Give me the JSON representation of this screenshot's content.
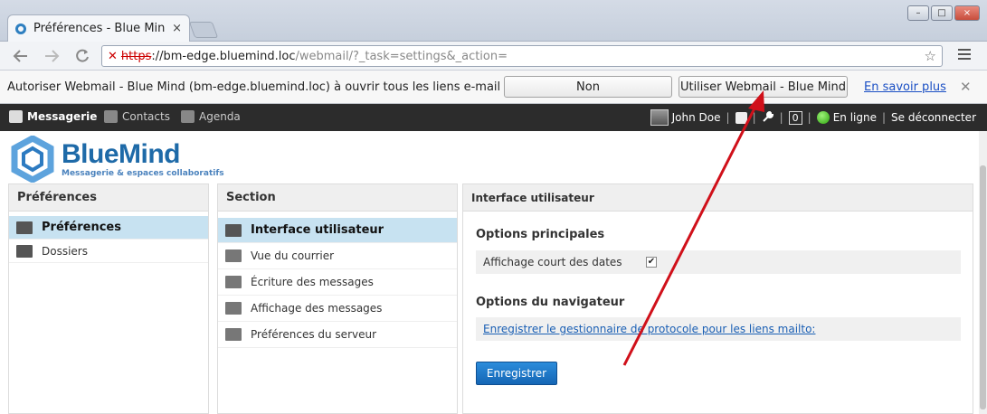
{
  "browser": {
    "tab_title": "Préférences - Blue Min",
    "tab_close": "×",
    "url_https": "https",
    "url_host": "://bm-edge.bluemind.loc",
    "url_path": "/webmail/?_task=settings&_action=",
    "url_star": "☆",
    "win_minimize": "–",
    "win_maximize": "□",
    "win_close": "×"
  },
  "infobar": {
    "message": "Autoriser Webmail - Blue Mind (bm-edge.bluemind.loc) à ouvrir tous les liens e-mail ?",
    "deny_label": "Non",
    "allow_label": "Utiliser Webmail - Blue Mind",
    "learn_more": "En savoir plus",
    "close": "✕"
  },
  "appbar": {
    "apps": [
      "Messagerie",
      "Contacts",
      "Agenda"
    ],
    "user_name": "John Doe",
    "separator": "|",
    "badge_count": "0",
    "status": "En ligne",
    "logout": "Se déconnecter"
  },
  "logo": {
    "title": "BlueMind",
    "subtitle": "Messagerie & espaces collaboratifs"
  },
  "prefs_panel": {
    "header": "Préférences",
    "items": [
      "Préférences",
      "Dossiers"
    ]
  },
  "section_panel": {
    "header": "Section",
    "items": [
      "Interface utilisateur",
      "Vue du courrier",
      "Écriture des messages",
      "Affichage des messages",
      "Préférences du serveur"
    ]
  },
  "content_panel": {
    "header": "Interface utilisateur",
    "main_options_title": "Options principales",
    "short_dates_label": "Affichage court des dates",
    "short_dates_checked": "✔",
    "browser_options_title": "Options du navigateur",
    "mailto_link": "Enregistrer le gestionnaire de protocole pour les liens mailto:",
    "save_label": "Enregistrer"
  },
  "colors": {
    "accent": "#1e6aa8",
    "selected_row": "#c7e2f1",
    "annotation_arrow": "#d0101a"
  }
}
